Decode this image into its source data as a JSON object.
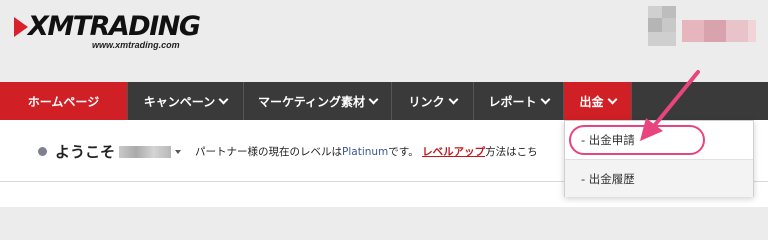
{
  "logo": {
    "brand": "XMTRADING",
    "url": "www.xmtrading.com"
  },
  "nav": {
    "items": [
      {
        "label": "ホームページ",
        "dropdown": false
      },
      {
        "label": "キャンペーン",
        "dropdown": true
      },
      {
        "label": "マーケティング素材",
        "dropdown": true
      },
      {
        "label": "リンク",
        "dropdown": true
      },
      {
        "label": "レポート",
        "dropdown": true
      },
      {
        "label": "出金",
        "dropdown": true
      }
    ]
  },
  "welcome": {
    "greeting": "ようこそ",
    "text_before": "パートナー様の現在のレベルは",
    "level": "Platinum",
    "text_middle": "です。",
    "levelup": "レベルアップ",
    "text_after": "方法はこち"
  },
  "withdraw_menu": {
    "items": [
      {
        "label": "- 出金申請"
      },
      {
        "label": "- 出金履歴"
      }
    ]
  },
  "colors": {
    "accent": "#d11f26",
    "nav_bg": "#3a3a3a",
    "annotation": "#e8447e"
  }
}
